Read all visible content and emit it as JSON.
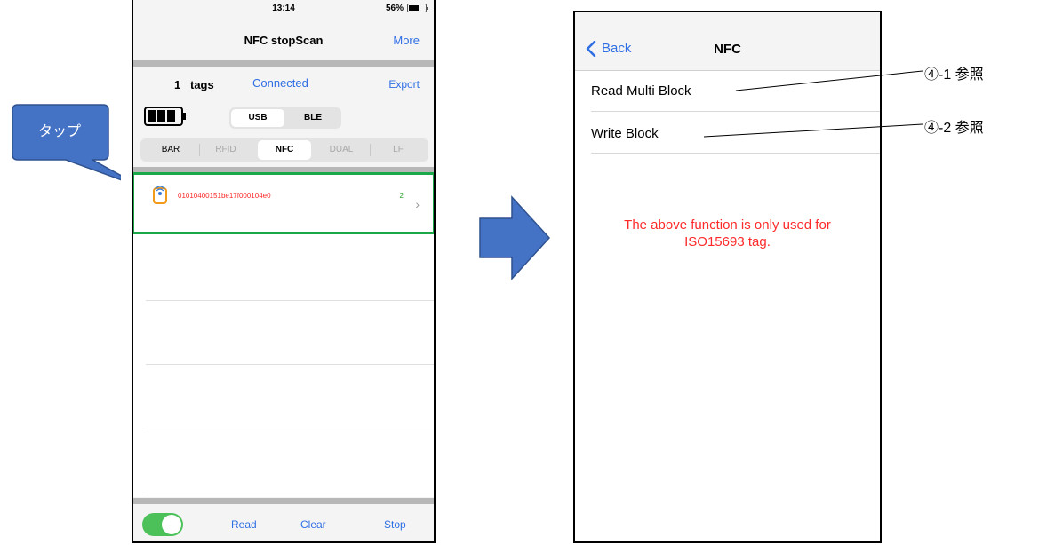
{
  "left_screen": {
    "status_bar": {
      "time": "13:14",
      "battery_percent": "56%"
    },
    "nav": {
      "title": "NFC stopScan",
      "more_label": "More"
    },
    "info": {
      "tag_count": "1",
      "tag_label": "tags",
      "connection_status": "Connected",
      "export_label": "Export"
    },
    "interface": {
      "options": [
        "USB",
        "BLE"
      ],
      "selected": "USB"
    },
    "mode_tabs": {
      "items": [
        "BAR",
        "RFID",
        "NFC",
        "DUAL",
        "LF"
      ],
      "selected": "NFC"
    },
    "tag_list": [
      {
        "uid": "01010400151be17f000104e0",
        "count": "2"
      }
    ],
    "toolbar": {
      "read_toggle_on": true,
      "read_label": "Read",
      "clear_label": "Clear",
      "stop_label": "Stop"
    }
  },
  "callout": {
    "text": "タップ"
  },
  "right_screen": {
    "nav": {
      "back_label": "Back",
      "title": "NFC"
    },
    "menu_items": [
      "Read Multi Block",
      "Write Block"
    ],
    "note": [
      "The above function is only used for",
      "ISO15693 tag."
    ]
  },
  "references": [
    "④-1 参照",
    "④-2 参照"
  ],
  "colors": {
    "link_blue": "#2f6fe4",
    "alert_red": "#ff2a2a",
    "highlight_green": "#1aa84a",
    "callout_blue": "#4472c4",
    "arrow_blue": "#4472c4",
    "toggle_green": "#4cc15a"
  }
}
